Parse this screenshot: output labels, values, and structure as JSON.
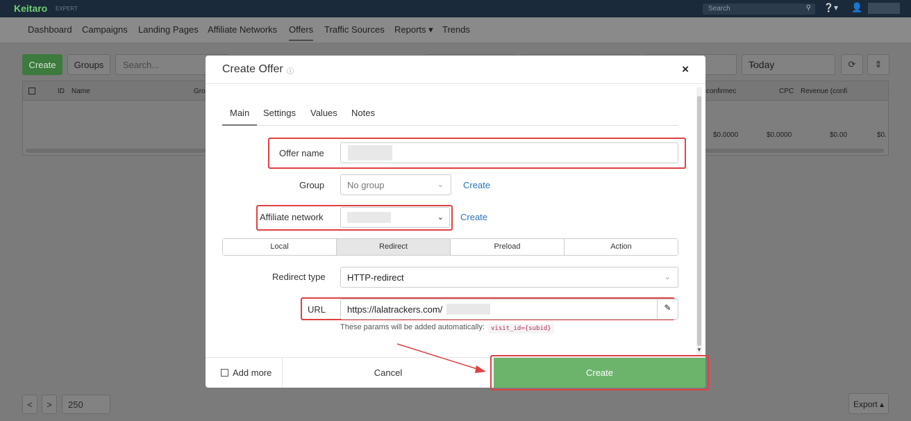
{
  "app": {
    "logo": "Keitaro",
    "edition": "EXPERT"
  },
  "topbar": {
    "search_placeholder": "Search",
    "help": "?",
    "user": "☺"
  },
  "nav": {
    "items": [
      {
        "label": "Dashboard"
      },
      {
        "label": "Campaigns"
      },
      {
        "label": "Landing Pages"
      },
      {
        "label": "Affiliate Networks"
      },
      {
        "label": "Offers"
      },
      {
        "label": "Traffic Sources"
      },
      {
        "label": "Reports ▾"
      },
      {
        "label": "Trends"
      }
    ],
    "active": "Offers"
  },
  "toolbar": {
    "create_label": "Create",
    "groups_label": "Groups",
    "search_placeholder": "Search...",
    "period_label": "Today"
  },
  "table": {
    "headers": [
      "ID",
      "Name",
      "Gro",
      "confirmec",
      "CPC",
      "Revenue (confi"
    ],
    "totals": [
      "$0.0000",
      "$0.0000",
      "$0.00",
      "$0."
    ]
  },
  "pagination": {
    "page_size": "250",
    "prev": "<",
    "next": ">",
    "export_label": "Export ▴"
  },
  "modal": {
    "title": "Create Offer",
    "help_icon": "ⓘ",
    "close": "×",
    "tabs": [
      "Main",
      "Settings",
      "Values",
      "Notes"
    ],
    "active_tab": "Main",
    "fields": {
      "offer_name_label": "Offer name",
      "group_label": "Group",
      "group_value": "No group",
      "group_create_link": "Create",
      "affiliate_label": "Affiliate network",
      "affiliate_create_link": "Create",
      "redirect_type_label": "Redirect type",
      "redirect_type_value": "HTTP-redirect",
      "url_label": "URL",
      "url_value": "https://lalatrackers.com/",
      "params_hint": "These params will be added automatically:",
      "params_code": "visit_id={subid}"
    },
    "offer_types": [
      "Local",
      "Redirect",
      "Preload",
      "Action"
    ],
    "active_offer_type": "Redirect",
    "footer": {
      "add_more_label": "Add more",
      "cancel_label": "Cancel",
      "create_label": "Create"
    }
  },
  "colors": {
    "highlight": "#e04040",
    "create_button": "#6cb46c",
    "link": "#2a72b8",
    "topbar": "#1b2a3a"
  }
}
